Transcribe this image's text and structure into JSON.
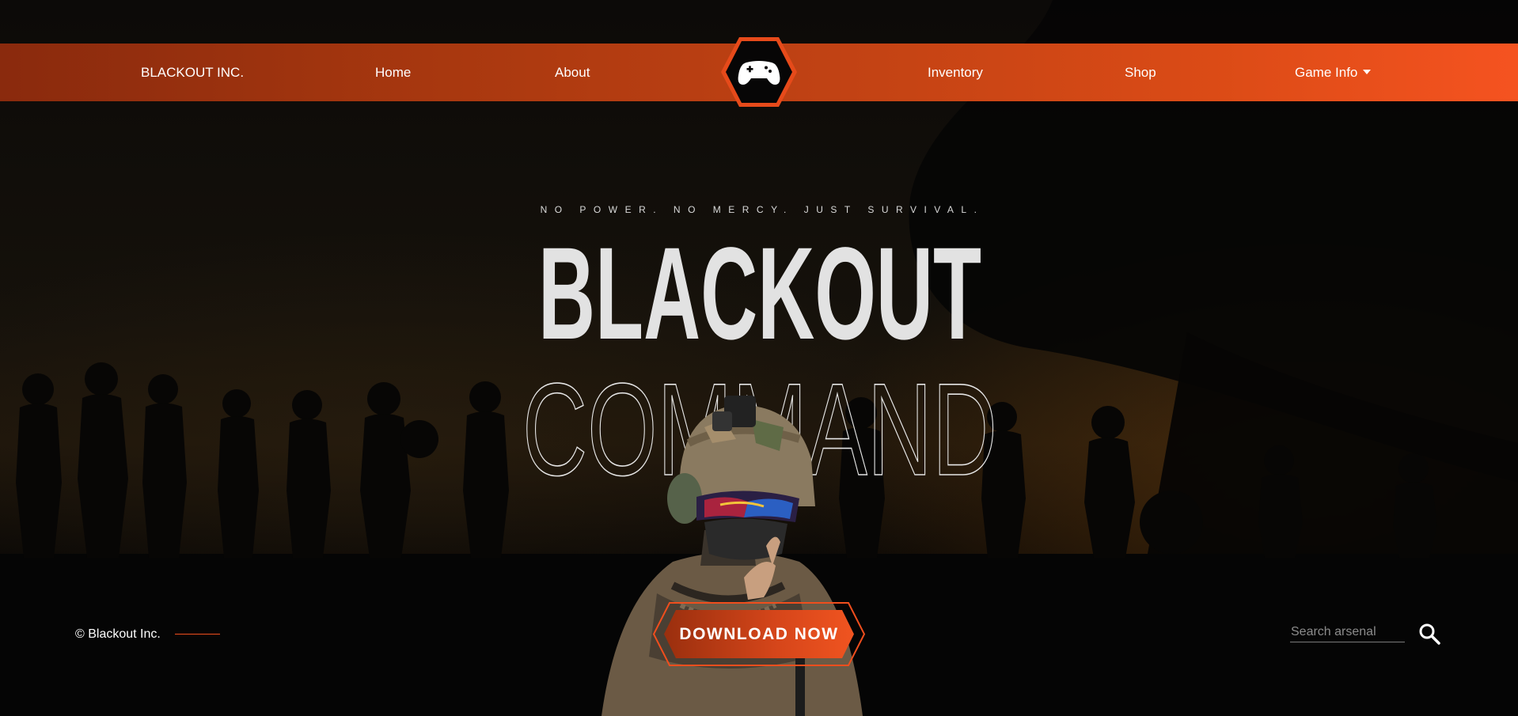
{
  "nav": {
    "brand": "BLACKOUT INC.",
    "items": [
      {
        "label": "Home"
      },
      {
        "label": "About"
      },
      {
        "label": "Inventory"
      },
      {
        "label": "Shop"
      },
      {
        "label": "Game Info"
      }
    ],
    "logo_icon": "gamepad-icon",
    "dropdown_icon": "caret-down-icon"
  },
  "hero": {
    "tagline": "NO POWER. NO MERCY. JUST SURVIVAL.",
    "title_line1": "BLACKOUT",
    "title_line2": "COMMAND"
  },
  "cta": {
    "download_label": "DOWNLOAD NOW"
  },
  "footer": {
    "copyright": "© Blackout Inc."
  },
  "search": {
    "placeholder": "Search arsenal",
    "icon": "search-icon"
  },
  "colors": {
    "accent": "#f04e1d",
    "accent_dark": "#8a2a0d",
    "background": "#070605",
    "title_fill": "#e2e2e2"
  }
}
